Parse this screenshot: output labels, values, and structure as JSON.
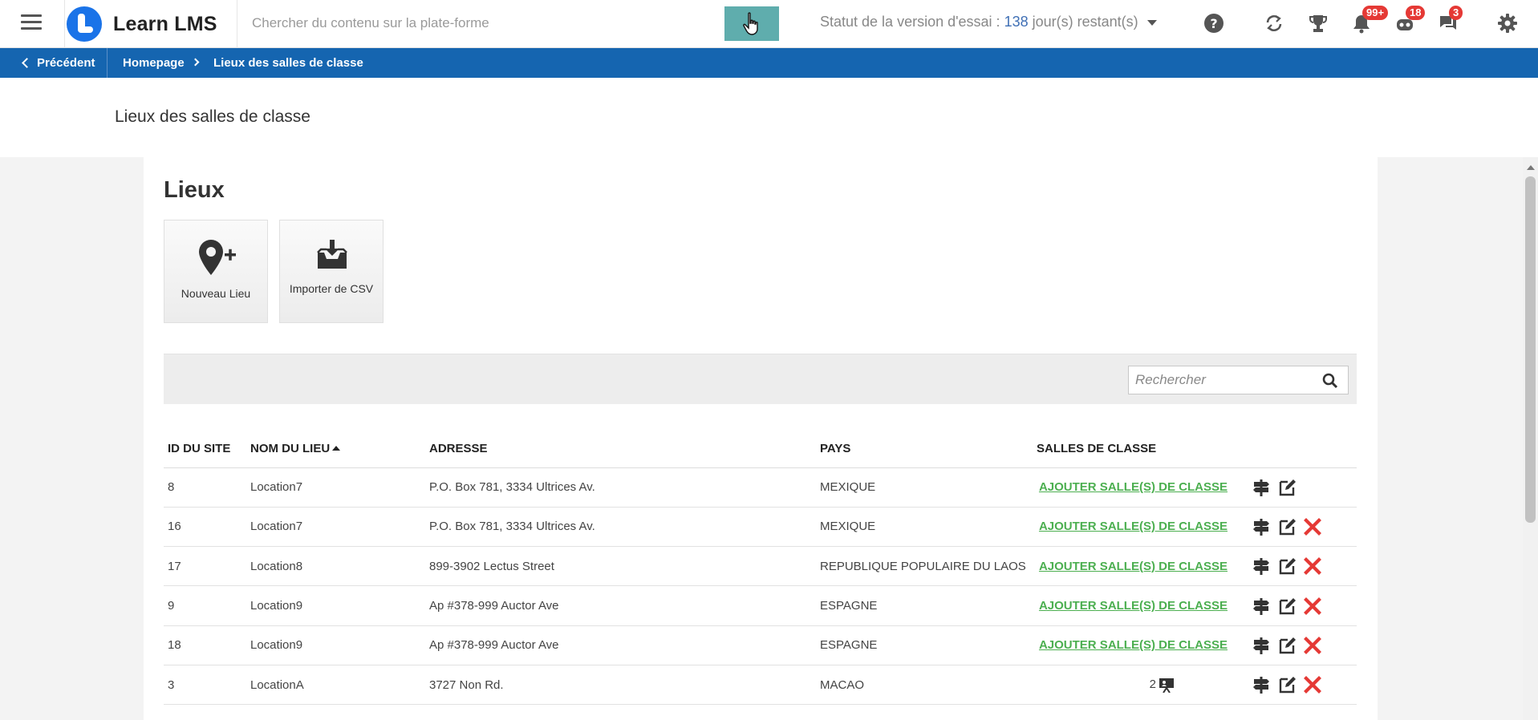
{
  "header": {
    "logo_text": "Learn LMS",
    "search_placeholder": "Chercher du contenu sur la plate-forme",
    "trial_label": "Statut de la version d'essai :",
    "trial_days": "138",
    "trial_suffix": "jour(s) restant(s)",
    "badges": {
      "notifications": "99+",
      "robot": "18",
      "messages": "3"
    }
  },
  "breadcrumb": {
    "back": "Précédent",
    "home": "Homepage",
    "current": "Lieux des salles de classe"
  },
  "page": {
    "title": "Lieux des salles de classe"
  },
  "panel": {
    "heading": "Lieux",
    "tiles": [
      {
        "label": "Nouveau Lieu",
        "icon": "map-pin-plus-icon"
      },
      {
        "label": "Importer de CSV",
        "icon": "inbox-download-icon"
      }
    ],
    "search_placeholder": "Rechercher"
  },
  "table": {
    "columns": [
      "ID DU SITE",
      "NOM DU LIEU",
      "ADRESSE",
      "PAYS",
      "SALLES DE CLASSE"
    ],
    "add_label": "AJOUTER SALLE(S) DE CLASSE",
    "rows": [
      {
        "id": "8",
        "name": "Location7",
        "address": "P.O. Box 781, 3334 Ultrices Av.",
        "country": "MEXIQUE",
        "rooms": "",
        "deletable": false
      },
      {
        "id": "16",
        "name": "Location7",
        "address": "P.O. Box 781, 3334 Ultrices Av.",
        "country": "MEXIQUE",
        "rooms": "",
        "deletable": true
      },
      {
        "id": "17",
        "name": "Location8",
        "address": "899-3902 Lectus Street",
        "country": "REPUBLIQUE POPULAIRE DU LAOS",
        "rooms": "",
        "deletable": true
      },
      {
        "id": "9",
        "name": "Location9",
        "address": "Ap #378-999 Auctor Ave",
        "country": "ESPAGNE",
        "rooms": "",
        "deletable": true
      },
      {
        "id": "18",
        "name": "Location9",
        "address": "Ap #378-999 Auctor Ave",
        "country": "ESPAGNE",
        "rooms": "",
        "deletable": true
      },
      {
        "id": "3",
        "name": "LocationA",
        "address": "3727 Non Rd.",
        "country": "MACAO",
        "rooms": "2",
        "deletable": true
      }
    ]
  },
  "colors": {
    "accent": "#1565b0",
    "link_green": "#4caf50",
    "delete_red": "#e53935",
    "search_btn": "#5fadad"
  }
}
